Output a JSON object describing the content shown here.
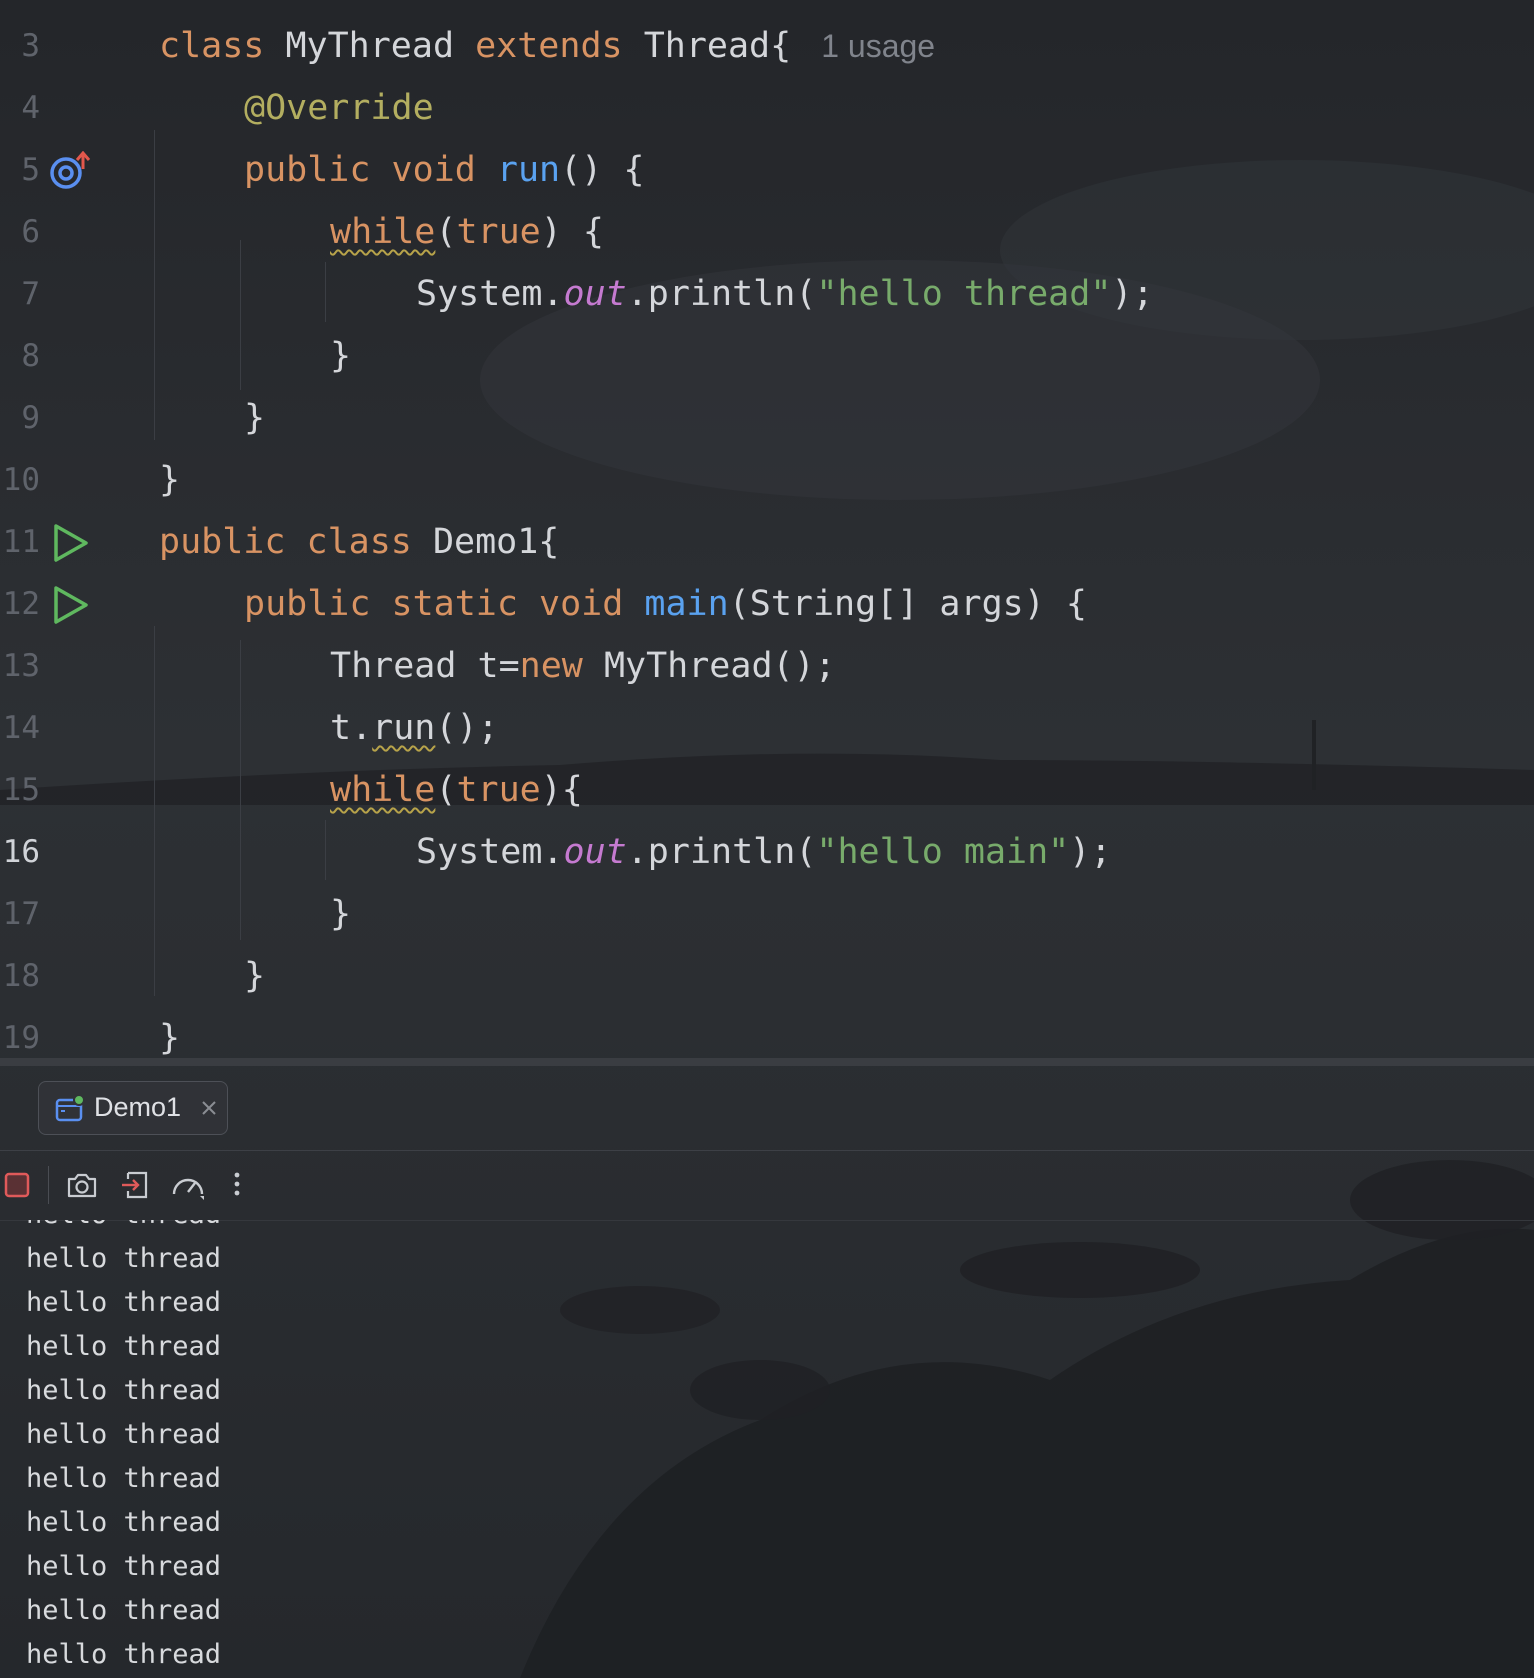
{
  "editor": {
    "lines": [
      {
        "num": "3"
      },
      {
        "num": "4"
      },
      {
        "num": "5"
      },
      {
        "num": "6"
      },
      {
        "num": "7"
      },
      {
        "num": "8"
      },
      {
        "num": "9"
      },
      {
        "num": "10"
      },
      {
        "num": "11"
      },
      {
        "num": "12"
      },
      {
        "num": "13"
      },
      {
        "num": "14"
      },
      {
        "num": "15"
      },
      {
        "num": "16"
      },
      {
        "num": "17"
      },
      {
        "num": "18"
      },
      {
        "num": "19"
      }
    ],
    "usage_hint": "1 usage",
    "current_line": "16",
    "tokens": {
      "class": "class",
      "mythread": "MyThread",
      "extends": "extends",
      "thread_brace": "Thread{",
      "override": "@Override",
      "public": "public",
      "void": "void",
      "run": "run",
      "paren_brace": "() {",
      "while": "while",
      "true": "true",
      "paren_close_brace": ") {",
      "system": "System.",
      "out": "out",
      "println_open": ".println(",
      "str_thread": "\"hello thread\"",
      "close_semi": ");",
      "rbrace": "}",
      "demo1": "Demo1{",
      "static": "static",
      "main": "main",
      "main_args": "(String[] args) {",
      "thread_t": "Thread t=",
      "new": "new",
      "mythread_ctor": "MyThread();",
      "t_dot": "t.",
      "run_call_end": "();",
      "paren_open": "(",
      "paren_close_lbrace": "){",
      "str_main": "\"hello main\""
    }
  },
  "run_tab": {
    "label": "Demo1"
  },
  "console": {
    "partial_line": "hello thread",
    "lines": [
      "hello thread",
      "hello thread",
      "hello thread",
      "hello thread",
      "hello thread",
      "hello thread",
      "hello thread",
      "hello thread",
      "hello thread",
      "hello thread"
    ]
  },
  "colors": {
    "keyword": "#d89363",
    "function": "#5aa2f0",
    "string": "#78ab6b",
    "annotation": "#b3ae60",
    "static_field": "#c57ad0",
    "stop_button": "#e05a5a",
    "run_gutter": "#5fb85f"
  }
}
